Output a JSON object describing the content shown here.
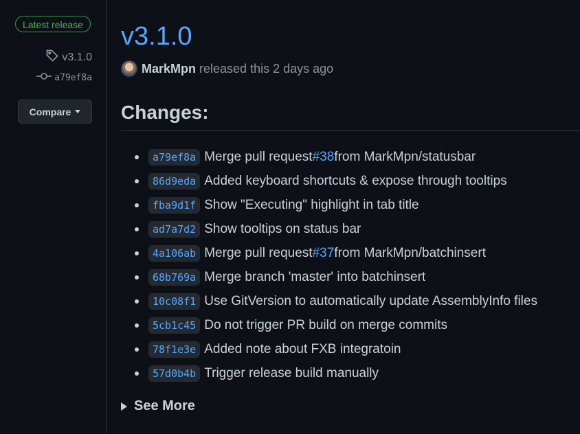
{
  "sidebar": {
    "badge": "Latest release",
    "tag": "v3.1.0",
    "commit": "a79ef8a",
    "compare_label": "Compare"
  },
  "release": {
    "version": "v3.1.0",
    "author": "MarkMpn",
    "released_text": "released this 2 days ago",
    "changes_heading": "Changes:",
    "commits": [
      {
        "sha": "a79ef8a",
        "before": "Merge pull request ",
        "pr": "#38",
        "after": " from MarkMpn/statusbar"
      },
      {
        "sha": "86d9eda",
        "before": "Added keyboard shortcuts & expose through tooltips",
        "pr": "",
        "after": ""
      },
      {
        "sha": "fba9d1f",
        "before": "Show \"Executing\" highlight in tab title",
        "pr": "",
        "after": ""
      },
      {
        "sha": "ad7a7d2",
        "before": "Show tooltips on status bar",
        "pr": "",
        "after": ""
      },
      {
        "sha": "4a106ab",
        "before": "Merge pull request ",
        "pr": "#37",
        "after": " from MarkMpn/batchinsert"
      },
      {
        "sha": "68b769a",
        "before": "Merge branch 'master' into batchinsert",
        "pr": "",
        "after": ""
      },
      {
        "sha": "10c08f1",
        "before": "Use GitVersion to automatically update AssemblyInfo files",
        "pr": "",
        "after": ""
      },
      {
        "sha": "5cb1c45",
        "before": "Do not trigger PR build on merge commits",
        "pr": "",
        "after": ""
      },
      {
        "sha": "78f1e3e",
        "before": "Added note about FXB integratoin",
        "pr": "",
        "after": ""
      },
      {
        "sha": "57d0b4b",
        "before": "Trigger release build manually",
        "pr": "",
        "after": ""
      }
    ],
    "see_more": "See More"
  },
  "colors": {
    "background": "#0d1117",
    "link": "#58a6ff",
    "badge_green": "#3fb950",
    "text": "#c9d1d9",
    "muted": "#8b949e"
  },
  "icons": {
    "tag": "tag-icon",
    "commit": "git-commit-icon",
    "caret": "triangle-down-icon",
    "see_more": "triangle-right-icon"
  }
}
